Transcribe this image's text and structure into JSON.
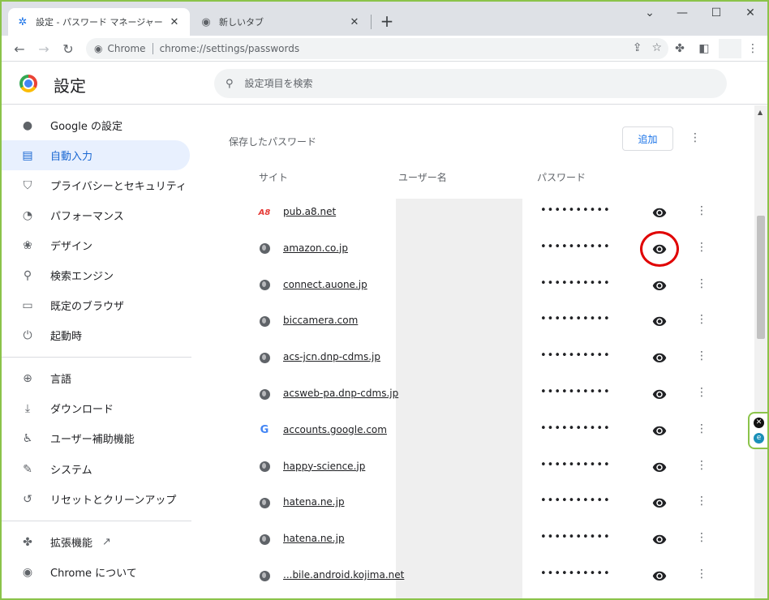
{
  "tabs": [
    {
      "title": "設定 - パスワード マネージャー",
      "icon": "gear-icon"
    },
    {
      "title": "新しいタブ",
      "icon": "chrome-icon"
    }
  ],
  "toolbar": {
    "omnibox_label": "Chrome",
    "url": "chrome://settings/passwords"
  },
  "settings": {
    "title": "設定",
    "search_placeholder": "設定項目を検索"
  },
  "sidebar": {
    "items": [
      {
        "label": "Google の設定",
        "icon": "person-icon"
      },
      {
        "label": "自動入力",
        "icon": "clipboard-icon",
        "selected": true
      },
      {
        "label": "プライバシーとセキュリティ",
        "icon": "shield-icon"
      },
      {
        "label": "パフォーマンス",
        "icon": "speedometer-icon"
      },
      {
        "label": "デザイン",
        "icon": "palette-icon"
      },
      {
        "label": "検索エンジン",
        "icon": "search-icon"
      },
      {
        "label": "既定のブラウザ",
        "icon": "browser-icon"
      },
      {
        "label": "起動時",
        "icon": "power-icon"
      },
      {
        "label": "言語",
        "icon": "globe-icon"
      },
      {
        "label": "ダウンロード",
        "icon": "download-icon"
      },
      {
        "label": "ユーザー補助機能",
        "icon": "accessibility-icon"
      },
      {
        "label": "システム",
        "icon": "wrench-icon"
      },
      {
        "label": "リセットとクリーンアップ",
        "icon": "reset-icon"
      },
      {
        "label": "拡張機能",
        "icon": "puzzle-icon"
      },
      {
        "label": "Chrome について",
        "icon": "chrome-icon"
      }
    ]
  },
  "passwords": {
    "section_title": "保存したパスワード",
    "add_button": "追加",
    "columns": {
      "site": "サイト",
      "username": "ユーザー名",
      "password": "パスワード"
    },
    "rows": [
      {
        "site": "pub.a8.net",
        "icon": "a8-icon",
        "password": "••••••••••"
      },
      {
        "site": "amazon.co.jp",
        "icon": "globe-icon",
        "password": "••••••••••",
        "highlighted": true
      },
      {
        "site": "connect.auone.jp",
        "icon": "globe-icon",
        "password": "••••••••••"
      },
      {
        "site": "biccamera.com",
        "icon": "globe-icon",
        "password": "••••••••••"
      },
      {
        "site": "acs-jcn.dnp-cdms.jp",
        "icon": "globe-icon",
        "password": "••••••••••"
      },
      {
        "site": "acsweb-pa.dnp-cdms.jp",
        "icon": "globe-icon",
        "password": "••••••••••"
      },
      {
        "site": "accounts.google.com",
        "icon": "google-icon",
        "password": "••••••••••"
      },
      {
        "site": "happy-science.jp",
        "icon": "globe-icon",
        "password": "••••••••••"
      },
      {
        "site": "hatena.ne.jp",
        "icon": "globe-icon",
        "password": "••••••••••"
      },
      {
        "site": "hatena.ne.jp",
        "icon": "globe-icon",
        "password": "••••••••••"
      },
      {
        "site": "...bile.android.kojima.net",
        "icon": "globe-icon",
        "password": "••••••••••"
      }
    ]
  },
  "colors": {
    "accent": "#1a73e8",
    "selected_bg": "#e8f0fe",
    "highlight_ring": "#e00000",
    "window_border": "#8bc34a"
  }
}
